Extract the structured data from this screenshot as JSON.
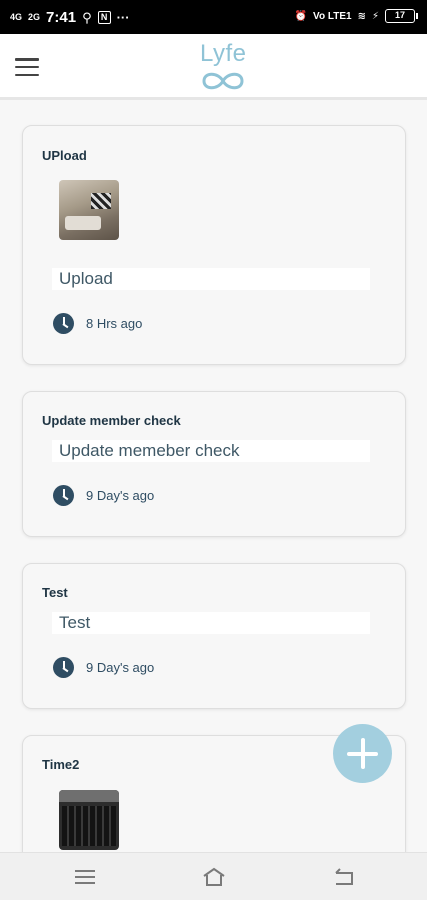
{
  "status_bar": {
    "signal_1": "4G",
    "signal_2": "2G",
    "time": "7:41",
    "network": "Vo LTE1",
    "battery": "17"
  },
  "header": {
    "logo_text": "Lyfe",
    "menu_icon": "hamburger-icon"
  },
  "posts": [
    {
      "title": "UPload",
      "description": "Upload",
      "time": "8 Hrs ago",
      "image": "living-room-photo"
    },
    {
      "title": "Update member check",
      "description": "Update memeber check",
      "time": "9 Day's ago"
    },
    {
      "title": "Test",
      "description": "Test",
      "time": "9 Day's ago"
    },
    {
      "title": "Time2",
      "image": "keyboard-photo"
    }
  ],
  "fab": {
    "icon": "plus-icon"
  },
  "nav_bar": {
    "icons": [
      "menu-icon",
      "home-icon",
      "back-icon"
    ]
  },
  "colors": {
    "accent": "#a3cfdf",
    "logo": "#8fc3d6",
    "title_text": "#1f3544",
    "clock": "#2f4d63"
  }
}
